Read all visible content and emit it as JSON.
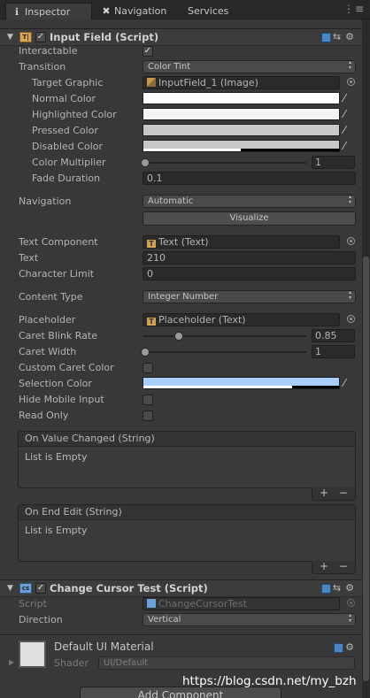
{
  "tabs": [
    {
      "label": "Inspector",
      "icon": "info-icon"
    },
    {
      "label": "Navigation",
      "icon": "navigation-icon"
    },
    {
      "label": "Services",
      "icon": ""
    }
  ],
  "input_field": {
    "title": "Input Field (Script)",
    "interactable_label": "Interactable",
    "transition_label": "Transition",
    "transition_value": "Color Tint",
    "target_graphic_label": "Target Graphic",
    "target_graphic_value": "InputField_1 (Image)",
    "normal_color_label": "Normal Color",
    "highlighted_color_label": "Highlighted Color",
    "pressed_color_label": "Pressed Color",
    "disabled_color_label": "Disabled Color",
    "color_multiplier_label": "Color Multiplier",
    "color_multiplier_value": "1",
    "fade_duration_label": "Fade Duration",
    "fade_duration_value": "0.1",
    "navigation_label": "Navigation",
    "navigation_value": "Automatic",
    "visualize_label": "Visualize",
    "text_component_label": "Text Component",
    "text_component_value": "Text (Text)",
    "text_label": "Text",
    "text_value": "210",
    "character_limit_label": "Character Limit",
    "character_limit_value": "0",
    "content_type_label": "Content Type",
    "content_type_value": "Integer Number",
    "placeholder_label": "Placeholder",
    "placeholder_value": "Placeholder (Text)",
    "caret_blink_rate_label": "Caret Blink Rate",
    "caret_blink_rate_value": "0.85",
    "caret_width_label": "Caret Width",
    "caret_width_value": "1",
    "custom_caret_color_label": "Custom Caret Color",
    "selection_color_label": "Selection Color",
    "selection_color": "#a8cefe",
    "hide_mobile_input_label": "Hide Mobile Input",
    "read_only_label": "Read Only",
    "on_value_changed_title": "On Value Changed (String)",
    "on_value_changed_body": "List is Empty",
    "on_end_edit_title": "On End Edit (String)",
    "on_end_edit_body": "List is Empty",
    "plus_minus": "+ −"
  },
  "change_cursor": {
    "title": "Change Cursor Test (Script)",
    "script_label": "Script",
    "script_value": "ChangeCursorTest",
    "direction_label": "Direction",
    "direction_value": "Vertical"
  },
  "material": {
    "title": "Default UI Material",
    "shader_label": "Shader",
    "shader_value": "UI/Default"
  },
  "add_component_label": "Add Component",
  "watermark": "https://blog.csdn.net/my_bzh"
}
